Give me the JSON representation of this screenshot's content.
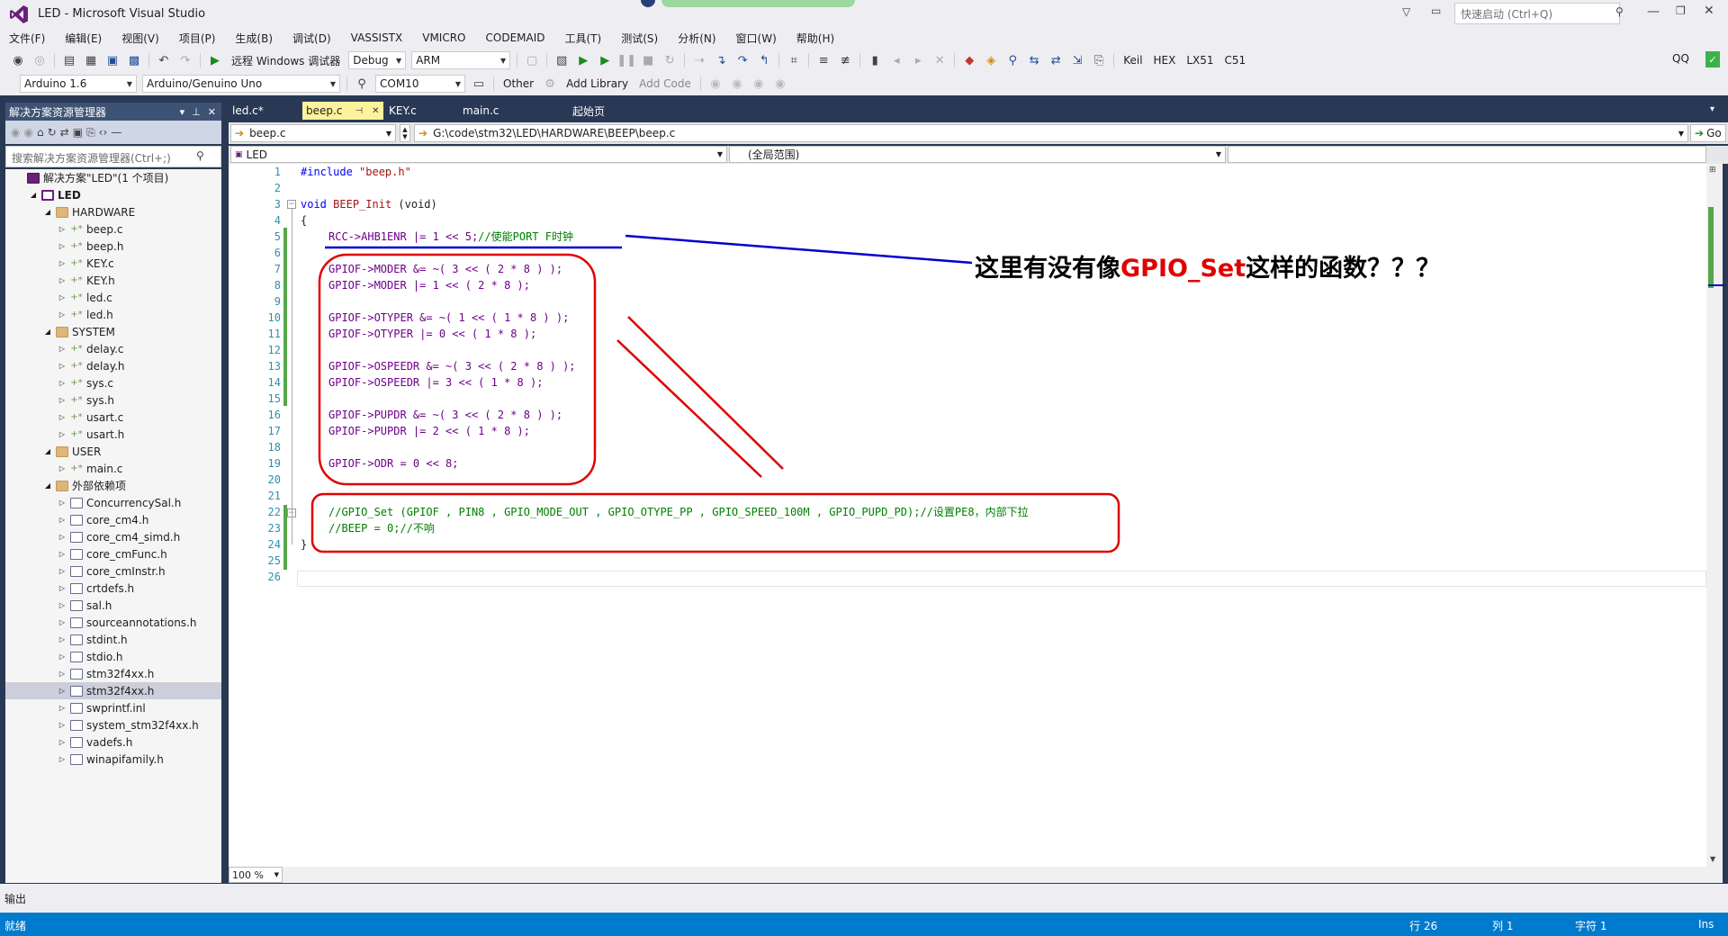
{
  "window": {
    "title": "LED - Microsoft Visual Studio",
    "quick_launch_placeholder": "快速启动 (Ctrl+Q)",
    "user": "QQ"
  },
  "menu": [
    "文件(F)",
    "编辑(E)",
    "视图(V)",
    "项目(P)",
    "生成(B)",
    "调试(D)",
    "VASSISTX",
    "VMICRO",
    "CODEMAID",
    "工具(T)",
    "测试(S)",
    "分析(N)",
    "窗口(W)",
    "帮助(H)"
  ],
  "toolbar1": {
    "debugger_label": "远程 Windows 调试器",
    "configuration": "Debug",
    "platform": "ARM",
    "keil": "Keil",
    "hex": "HEX",
    "lx51": "LX51",
    "c51": "C51"
  },
  "toolbar2": {
    "ide_version": "Arduino 1.6",
    "board": "Arduino/Genuino Uno",
    "port": "COM10",
    "other": "Other",
    "add_library": "Add Library",
    "add_code": "Add Code"
  },
  "solution_explorer": {
    "title": "解决方案资源管理器",
    "search_placeholder": "搜索解决方案资源管理器(Ctrl+;)",
    "items": [
      {
        "label": "解决方案\"LED\"(1 个项目)",
        "depth": 0,
        "type": "sol",
        "toggle": ""
      },
      {
        "label": "LED",
        "depth": 1,
        "type": "proj",
        "toggle": "◢",
        "bold": true
      },
      {
        "label": "HARDWARE",
        "depth": 2,
        "type": "folder",
        "toggle": "◢"
      },
      {
        "label": "beep.c",
        "depth": 3,
        "type": "plus",
        "toggle": "▷"
      },
      {
        "label": "beep.h",
        "depth": 3,
        "type": "plus",
        "toggle": "▷"
      },
      {
        "label": "KEY.c",
        "depth": 3,
        "type": "plus",
        "toggle": "▷"
      },
      {
        "label": "KEY.h",
        "depth": 3,
        "type": "plus",
        "toggle": "▷"
      },
      {
        "label": "led.c",
        "depth": 3,
        "type": "plus",
        "toggle": "▷"
      },
      {
        "label": "led.h",
        "depth": 3,
        "type": "plus",
        "toggle": "▷"
      },
      {
        "label": "SYSTEM",
        "depth": 2,
        "type": "folder",
        "toggle": "◢"
      },
      {
        "label": "delay.c",
        "depth": 3,
        "type": "plus",
        "toggle": "▷"
      },
      {
        "label": "delay.h",
        "depth": 3,
        "type": "plus",
        "toggle": "▷"
      },
      {
        "label": "sys.c",
        "depth": 3,
        "type": "plus",
        "toggle": "▷"
      },
      {
        "label": "sys.h",
        "depth": 3,
        "type": "plus",
        "toggle": "▷"
      },
      {
        "label": "usart.c",
        "depth": 3,
        "type": "plus",
        "toggle": "▷"
      },
      {
        "label": "usart.h",
        "depth": 3,
        "type": "plus",
        "toggle": "▷"
      },
      {
        "label": "USER",
        "depth": 2,
        "type": "folder",
        "toggle": "◢"
      },
      {
        "label": "main.c",
        "depth": 3,
        "type": "plus",
        "toggle": "▷"
      },
      {
        "label": "外部依赖项",
        "depth": 2,
        "type": "folder",
        "toggle": "◢"
      },
      {
        "label": "ConcurrencySal.h",
        "depth": 3,
        "type": "file",
        "toggle": "▷"
      },
      {
        "label": "core_cm4.h",
        "depth": 3,
        "type": "file",
        "toggle": "▷"
      },
      {
        "label": "core_cm4_simd.h",
        "depth": 3,
        "type": "file",
        "toggle": "▷"
      },
      {
        "label": "core_cmFunc.h",
        "depth": 3,
        "type": "file",
        "toggle": "▷"
      },
      {
        "label": "core_cmInstr.h",
        "depth": 3,
        "type": "file",
        "toggle": "▷"
      },
      {
        "label": "crtdefs.h",
        "depth": 3,
        "type": "file",
        "toggle": "▷"
      },
      {
        "label": "sal.h",
        "depth": 3,
        "type": "file",
        "toggle": "▷"
      },
      {
        "label": "sourceannotations.h",
        "depth": 3,
        "type": "file",
        "toggle": "▷"
      },
      {
        "label": "stdint.h",
        "depth": 3,
        "type": "file",
        "toggle": "▷"
      },
      {
        "label": "stdio.h",
        "depth": 3,
        "type": "file",
        "toggle": "▷"
      },
      {
        "label": "stm32f4xx.h",
        "depth": 3,
        "type": "file",
        "toggle": "▷"
      },
      {
        "label": "stm32f4xx.h",
        "depth": 3,
        "type": "file",
        "toggle": "▷",
        "selected": true
      },
      {
        "label": "swprintf.inl",
        "depth": 3,
        "type": "file",
        "toggle": "▷"
      },
      {
        "label": "system_stm32f4xx.h",
        "depth": 3,
        "type": "file",
        "toggle": "▷"
      },
      {
        "label": "vadefs.h",
        "depth": 3,
        "type": "file",
        "toggle": "▷"
      },
      {
        "label": "winapifamily.h",
        "depth": 3,
        "type": "file",
        "toggle": "▷"
      }
    ]
  },
  "tabs": [
    {
      "label": "led.c*",
      "active": false
    },
    {
      "label": "beep.c",
      "active": true
    },
    {
      "label": "KEY.c",
      "active": false
    },
    {
      "label": "main.c",
      "active": false
    },
    {
      "label": "起始页",
      "active": false
    }
  ],
  "nav": {
    "file_combo": "beep.c",
    "path": "G:\\code\\stm32\\LED\\HARDWARE\\BEEP\\beep.c",
    "go": "Go",
    "project": "LED",
    "scope": "(全局范围)",
    "member": ""
  },
  "code_lines": [
    "1",
    "2",
    "3",
    "4",
    "5",
    "6",
    "7",
    "8",
    "9",
    "10",
    "11",
    "12",
    "13",
    "14",
    "15",
    "16",
    "17",
    "18",
    "19",
    "20",
    "21",
    "22",
    "23",
    "24",
    "25",
    "26"
  ],
  "code": {
    "l1": "#include \"beep.h\"",
    "l3_kw": "void",
    "l3_fn": "BEEP_Init",
    "l3_rest": " (void)",
    "l4": "{",
    "l5": "RCC->AHB1ENR |= 1 << 5;",
    "l5_cm": "//使能PORT F时钟",
    "l7": "GPIOF->MODER &= ~( 3 << ( 2 * 8 ) );",
    "l8": "GPIOF->MODER |= 1 << ( 2 * 8 );",
    "l10": "GPIOF->OTYPER &= ~( 1 << ( 1 * 8 ) );",
    "l11": "GPIOF->OTYPER |= 0 << ( 1 * 8 );",
    "l13": "GPIOF->OSPEEDR &= ~( 3 << ( 2 * 8 ) );",
    "l14": "GPIOF->OSPEEDR |= 3 << ( 1 * 8 );",
    "l16": "GPIOF->PUPDR &= ~( 3 << ( 2 * 8 ) );",
    "l17": "GPIOF->PUPDR |= 2 << ( 1 * 8 );",
    "l19": "GPIOF->ODR = 0 << 8;",
    "l22": "//GPIO_Set (GPIOF , PIN8 , GPIO_MODE_OUT , GPIO_OTYPE_PP , GPIO_SPEED_100M , GPIO_PUPD_PD);//设置PE8，内部下拉",
    "l23": "//BEEP = 0;//不响",
    "l24": "}"
  },
  "zoom": "100 %",
  "output_label": "输出",
  "status": {
    "ready": "就绪",
    "line": "行 26",
    "col": "列 1",
    "char": "字符 1",
    "ins": "Ins"
  },
  "annotation": {
    "prefix": "这里有没有像",
    "highlight": "GPIO_Set",
    "suffix": "这样的函数？？？"
  },
  "colors": {
    "frame": "#293955",
    "status": "#007acc",
    "tab_active": "#fff29d",
    "annotation_red": "#e00000",
    "annotation_blue": "#0000cc"
  }
}
